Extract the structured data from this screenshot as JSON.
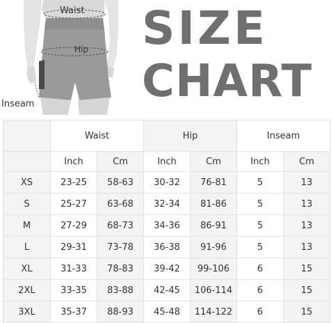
{
  "diagram": {
    "waist_label": "Waist",
    "hip_label": "Hip",
    "inseam_label": "Inseam"
  },
  "title": {
    "line1": "SIZE",
    "line2": "CHART"
  },
  "table": {
    "groups": [
      "Waist",
      "Hip",
      "Inseam"
    ],
    "units": [
      "Inch",
      "Cm",
      "Inch",
      "Cm",
      "Inch",
      "Cm"
    ],
    "rows": [
      {
        "size": "XS",
        "waist_in": "23-25",
        "waist_cm": "58-63",
        "hip_in": "30-32",
        "hip_cm": "76-81",
        "inseam_in": "5",
        "inseam_cm": "13"
      },
      {
        "size": "S",
        "waist_in": "25-27",
        "waist_cm": "63-68",
        "hip_in": "32-34",
        "hip_cm": "81-86",
        "inseam_in": "5",
        "inseam_cm": "13"
      },
      {
        "size": "M",
        "waist_in": "27-29",
        "waist_cm": "68-73",
        "hip_in": "34-36",
        "hip_cm": "86-91",
        "inseam_in": "5",
        "inseam_cm": "13"
      },
      {
        "size": "L",
        "waist_in": "29-31",
        "waist_cm": "73-78",
        "hip_in": "36-38",
        "hip_cm": "91-96",
        "inseam_in": "5",
        "inseam_cm": "13"
      },
      {
        "size": "XL",
        "waist_in": "31-33",
        "waist_cm": "78-83",
        "hip_in": "39-42",
        "hip_cm": "99-106",
        "inseam_in": "6",
        "inseam_cm": "15"
      },
      {
        "size": "2XL",
        "waist_in": "33-35",
        "waist_cm": "83-88",
        "hip_in": "42-45",
        "hip_cm": "106-114",
        "inseam_in": "6",
        "inseam_cm": "15"
      },
      {
        "size": "3XL",
        "waist_in": "35-37",
        "waist_cm": "88-93",
        "hip_in": "45-48",
        "hip_cm": "114-122",
        "inseam_in": "6",
        "inseam_cm": "15"
      }
    ]
  }
}
